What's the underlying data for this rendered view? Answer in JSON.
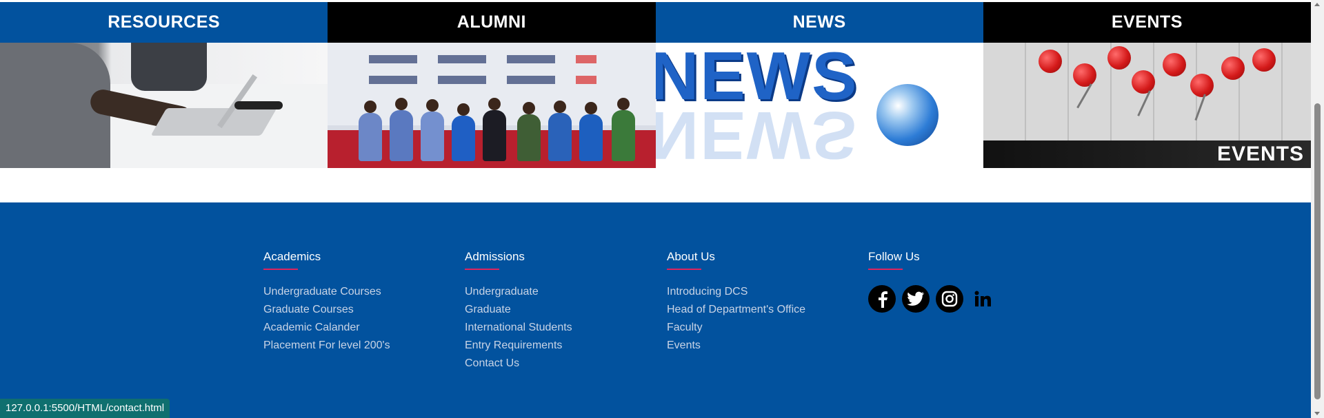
{
  "tiles": [
    {
      "title": "RESOURCES",
      "header_color": "#02529e"
    },
    {
      "title": "ALUMNI",
      "header_color": "#000000"
    },
    {
      "title": "NEWS",
      "header_color": "#02529e",
      "image_word": "NEWS"
    },
    {
      "title": "EVENTS",
      "header_color": "#000000",
      "image_label": "EVENTS"
    }
  ],
  "footer": {
    "background": "#02529e",
    "accent": "#e0245e",
    "columns": [
      {
        "heading": "Academics",
        "links": [
          "Undergraduate Courses",
          "Graduate Courses",
          "Academic Calander",
          "Placement For level 200's"
        ]
      },
      {
        "heading": "Admissions",
        "links": [
          "Undergraduate",
          "Graduate",
          "International Students",
          "Entry Requirements",
          "Contact Us"
        ]
      },
      {
        "heading": "About Us",
        "links": [
          "Introducing DCS",
          "Head of Department's Office",
          "Faculty",
          "Events"
        ]
      },
      {
        "heading": "Follow Us",
        "social": [
          "facebook-icon",
          "twitter-icon",
          "instagram-icon",
          "linkedin-icon"
        ]
      }
    ]
  },
  "status_bar": {
    "url": "127.0.0.1:5500/HTML/contact.html"
  }
}
